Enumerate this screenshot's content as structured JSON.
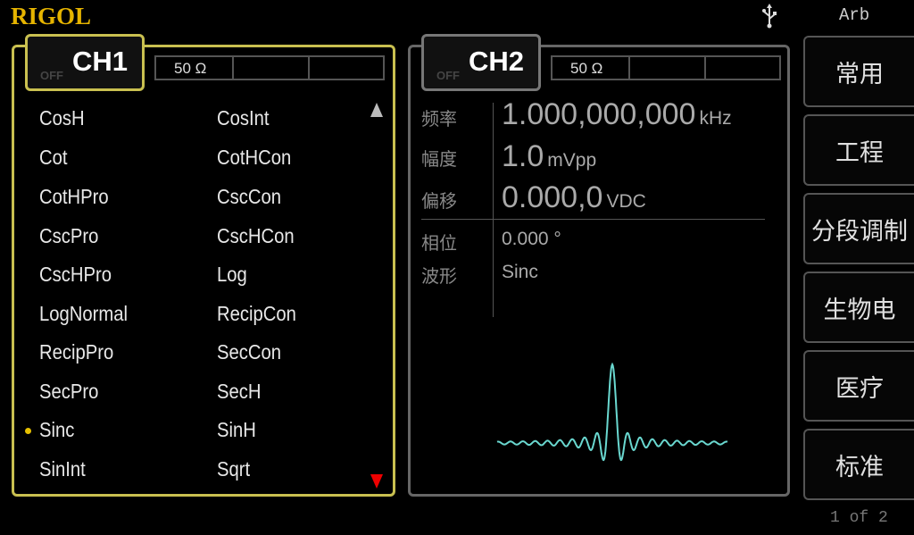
{
  "header": {
    "brand": "RIGOL",
    "usb_icon": "usb-icon",
    "mode": "Arb"
  },
  "ch1": {
    "off_label": "OFF",
    "title": "CH1",
    "load": "50 Ω",
    "waveforms_left": [
      "CosH",
      "Cot",
      "CotHPro",
      "CscPro",
      "CscHPro",
      "LogNormal",
      "RecipPro",
      "SecPro",
      "Sinc",
      "SinInt"
    ],
    "waveforms_right": [
      "CosInt",
      "CotHCon",
      "CscCon",
      "CscHCon",
      "Log",
      "RecipCon",
      "SecCon",
      "SecH",
      "SinH",
      "Sqrt"
    ],
    "selected": "Sinc",
    "colors": {
      "active_border": "#c9c050",
      "selected_dot": "#e6c000",
      "scroll_down": "#e00000"
    }
  },
  "ch2": {
    "off_label": "OFF",
    "title": "CH2",
    "load": "50 Ω",
    "params": {
      "freq_label": "频率",
      "freq_value": "1.000,000,000",
      "freq_unit": "kHz",
      "amp_label": "幅度",
      "amp_value": "1.0",
      "amp_unit": "mVpp",
      "offset_label": "偏移",
      "offset_value": "0.000,0",
      "offset_unit": "VDC",
      "phase_label": "相位",
      "phase_value": "0.000 °",
      "wave_label": "波形",
      "wave_value": "Sinc"
    },
    "preview_color": "#6ad8d0"
  },
  "softkeys": [
    "常用",
    "工程",
    "分段调制",
    "生物电",
    "医疗",
    "标准"
  ],
  "page_indicator": "1 of 2"
}
